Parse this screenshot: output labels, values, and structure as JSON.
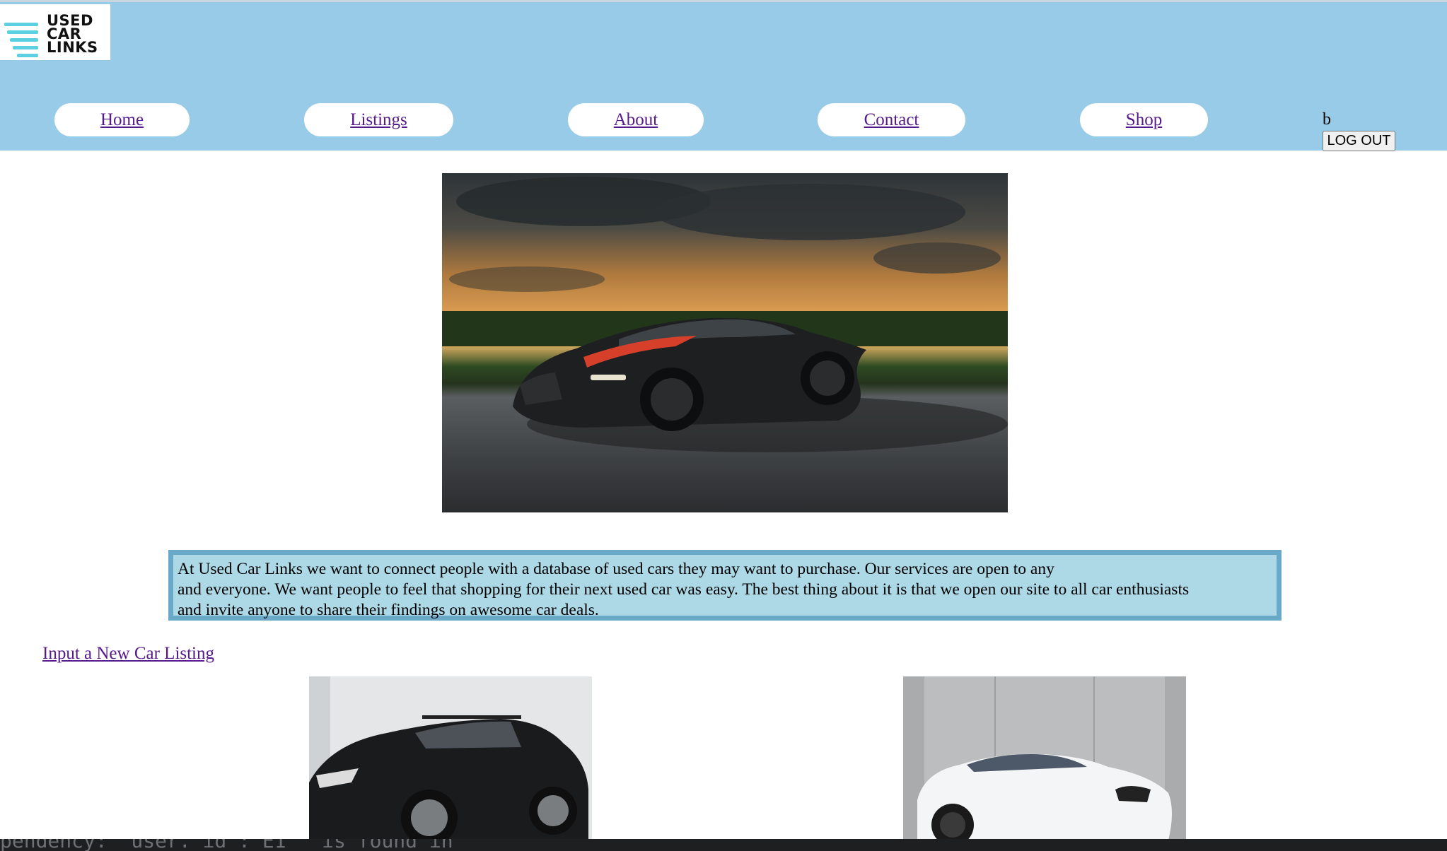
{
  "header": {
    "logo": {
      "line1": "USED",
      "line2": "CAR",
      "line3": "LINKS"
    },
    "nav": [
      {
        "label": "Home"
      },
      {
        "label": "Listings"
      },
      {
        "label": "About"
      },
      {
        "label": "Contact"
      },
      {
        "label": "Shop"
      }
    ],
    "user": {
      "name": "b",
      "logout_label": "LOG OUT"
    },
    "background_color": "#98cbe8"
  },
  "hero": {
    "subject": "black hypercar on asphalt at sunset"
  },
  "about": {
    "line1": "At Used Car Links we want to connect people with a database of used cars they may want to purchase. Our services are open to any",
    "line2": "and everyone. We want people to feel that shopping for their next used car was easy. The best thing about it is that we open our site to all car enthusiasts",
    "line3": "and invite anyone to share their findings on awesome car deals.",
    "background_color": "#add8e6",
    "border_color": "#6aa9c8"
  },
  "actions": {
    "new_listing_label": "Input a New Car Listing"
  },
  "listings": [
    {
      "subject": "black SUV in showroom"
    },
    {
      "subject": "white sedan in front of concrete wall"
    }
  ],
  "terminal": {
    "text": "pendency: `user._id`: E1   is found in"
  }
}
